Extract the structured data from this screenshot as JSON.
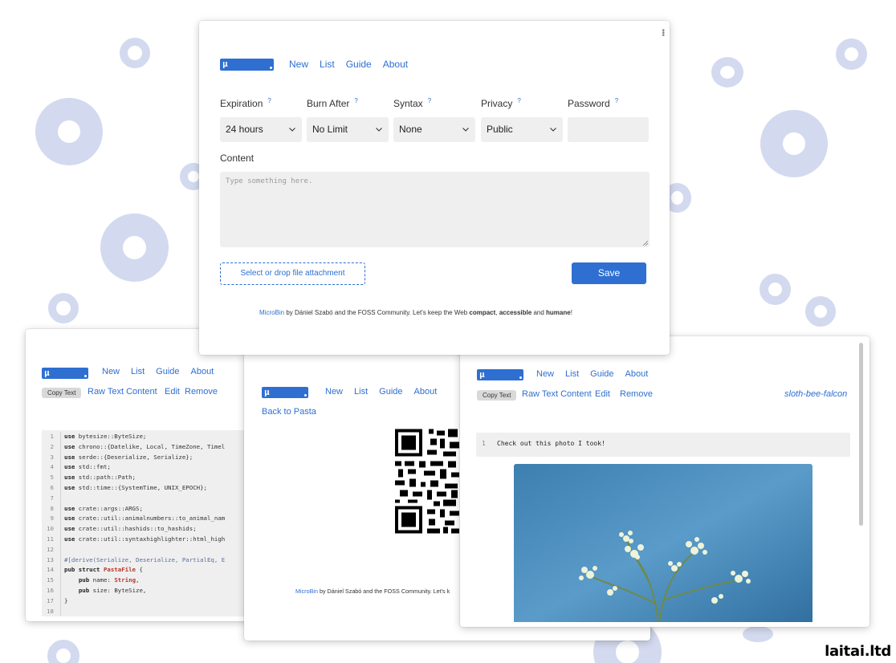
{
  "brand": {
    "logo_glyph": "µ",
    "accent": "#2e6fd1"
  },
  "nav": {
    "new": "New",
    "list": "List",
    "guide": "Guide",
    "about": "About"
  },
  "form": {
    "expiration": {
      "label": "Expiration",
      "help": "?",
      "value": "24 hours"
    },
    "burn_after": {
      "label": "Burn After",
      "help": "?",
      "value": "No Limit"
    },
    "syntax": {
      "label": "Syntax",
      "help": "?",
      "value": "None"
    },
    "privacy": {
      "label": "Privacy",
      "help": "?",
      "value": "Public"
    },
    "password": {
      "label": "Password",
      "help": "?",
      "value": ""
    },
    "content_label": "Content",
    "content_placeholder": "Type something here.",
    "attach_label": "Select or drop file attachment",
    "save_label": "Save"
  },
  "footer": {
    "microbin": "MicroBin",
    "by": " by Dániel Szabó and the FOSS Community. Let's keep the Web ",
    "compact": "compact",
    "comma": ", ",
    "accessible": "accessible",
    "and": " and ",
    "humane": "humane",
    "bang": "!",
    "short": " by Dániel Szabó and the FOSS Community. Let's k"
  },
  "pasta_actions": {
    "copy": "Copy Text",
    "raw": "Raw Text Content",
    "edit": "Edit",
    "remove": "Remove"
  },
  "qr_page": {
    "back": "Back to Pasta"
  },
  "code_lines": [
    {
      "n": "1",
      "kw": "use",
      "rest": " bytesize::ByteSize;"
    },
    {
      "n": "2",
      "kw": "use",
      "rest": " chrono::{Datelike, Local, TimeZone, Timel"
    },
    {
      "n": "3",
      "kw": "use",
      "rest": " serde::{Deserialize, Serialize};"
    },
    {
      "n": "4",
      "kw": "use",
      "rest": " std::fmt;"
    },
    {
      "n": "5",
      "kw": "use",
      "rest": " std::path::Path;"
    },
    {
      "n": "6",
      "kw": "use",
      "rest": " std::time::{SystemTime, UNIX_EPOCH};"
    },
    {
      "n": "7",
      "kw": "",
      "rest": ""
    },
    {
      "n": "8",
      "kw": "use",
      "rest": " crate::args::ARGS;"
    },
    {
      "n": "9",
      "kw": "use",
      "rest": " crate::util::animalnumbers::to_animal_nam"
    },
    {
      "n": "10",
      "kw": "use",
      "rest": " crate::util::hashids::to_hashids;"
    },
    {
      "n": "11",
      "kw": "use",
      "rest": " crate::util::syntaxhighlighter::html_high"
    },
    {
      "n": "12",
      "kw": "",
      "rest": ""
    },
    {
      "n": "13",
      "attr": "#[derive(Serialize, Deserialize, PartialEq, E"
    },
    {
      "n": "14",
      "kw": "pub struct",
      "ty": " PastaFile",
      "rest": " {"
    },
    {
      "n": "15",
      "ind": "    ",
      "kw": "pub",
      "rest": " name: ",
      "ty2": "String",
      "rest2": ","
    },
    {
      "n": "16",
      "ind": "    ",
      "kw": "pub",
      "rest": " size: ByteSize,"
    },
    {
      "n": "17",
      "kw": "",
      "rest": "}"
    },
    {
      "n": "18",
      "kw": "",
      "rest": ""
    }
  ],
  "photo_pasta": {
    "slug": "sloth-bee-falcon",
    "line_no": "1",
    "text": "Check out this photo I took!"
  },
  "watermark": "laitai.ltd"
}
